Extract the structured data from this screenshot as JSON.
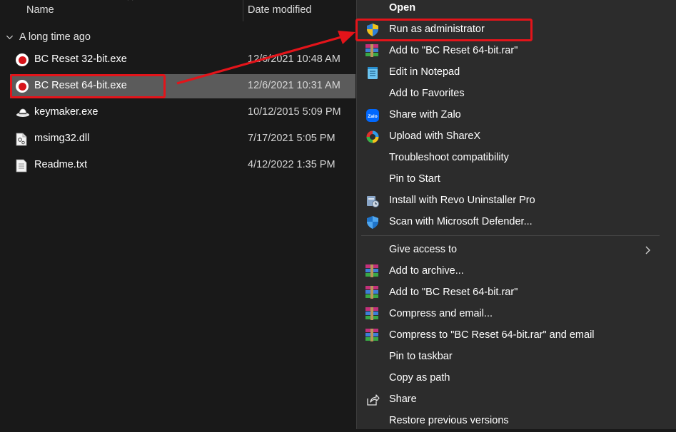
{
  "explorer": {
    "columns": {
      "name": "Name",
      "date_modified": "Date modified"
    },
    "group_label": "A long time ago",
    "files": [
      {
        "name": "BC Reset 32-bit.exe",
        "date": "12/6/2021 10:48 AM",
        "icon": "record-icon"
      },
      {
        "name": "BC Reset 64-bit.exe",
        "date": "12/6/2021 10:31 AM",
        "icon": "record-icon"
      },
      {
        "name": "keymaker.exe",
        "date": "10/12/2015 5:09 PM",
        "icon": "keymaker-icon"
      },
      {
        "name": "msimg32.dll",
        "date": "7/17/2021 5:05 PM",
        "icon": "dll-file-icon"
      },
      {
        "name": "Readme.txt",
        "date": "4/12/2022 1:35 PM",
        "icon": "text-file-icon"
      }
    ],
    "selected_file": "BC Reset 64-bit.exe"
  },
  "context_menu": {
    "items": [
      {
        "label": "Open",
        "icon": ""
      },
      {
        "label": "Run as administrator",
        "icon": "uac-shield-icon"
      },
      {
        "label": "Add to \"BC Reset 64-bit.rar\"",
        "icon": "winrar-icon"
      },
      {
        "label": "Edit in Notepad",
        "icon": "notepad-icon"
      },
      {
        "label": "Add to Favorites",
        "icon": ""
      },
      {
        "label": "Share with Zalo",
        "icon": "zalo-icon"
      },
      {
        "label": "Upload with ShareX",
        "icon": "sharex-icon"
      },
      {
        "label": "Troubleshoot compatibility",
        "icon": ""
      },
      {
        "label": "Pin to Start",
        "icon": ""
      },
      {
        "label": "Install with Revo Uninstaller Pro",
        "icon": "revo-uninstaller-icon"
      },
      {
        "label": "Scan with Microsoft Defender...",
        "icon": "defender-shield-icon"
      },
      {
        "label": "Give access to",
        "icon": ""
      },
      {
        "label": "Add to archive...",
        "icon": "winrar-icon"
      },
      {
        "label": "Add to \"BC Reset 64-bit.rar\"",
        "icon": "winrar-icon"
      },
      {
        "label": "Compress and email...",
        "icon": "winrar-icon"
      },
      {
        "label": "Compress to \"BC Reset 64-bit.rar\" and email",
        "icon": "winrar-icon"
      },
      {
        "label": "Pin to taskbar",
        "icon": ""
      },
      {
        "label": "Copy as path",
        "icon": ""
      },
      {
        "label": "Share",
        "icon": "share-icon"
      },
      {
        "label": "Restore previous versions",
        "icon": ""
      }
    ],
    "highlighted_item": "Run as administrator"
  },
  "colors": {
    "explorer_bg": "#191919",
    "menu_bg": "#2c2c2c",
    "selection_bg": "#5b5b5b",
    "annotation_red": "#e3141a"
  }
}
